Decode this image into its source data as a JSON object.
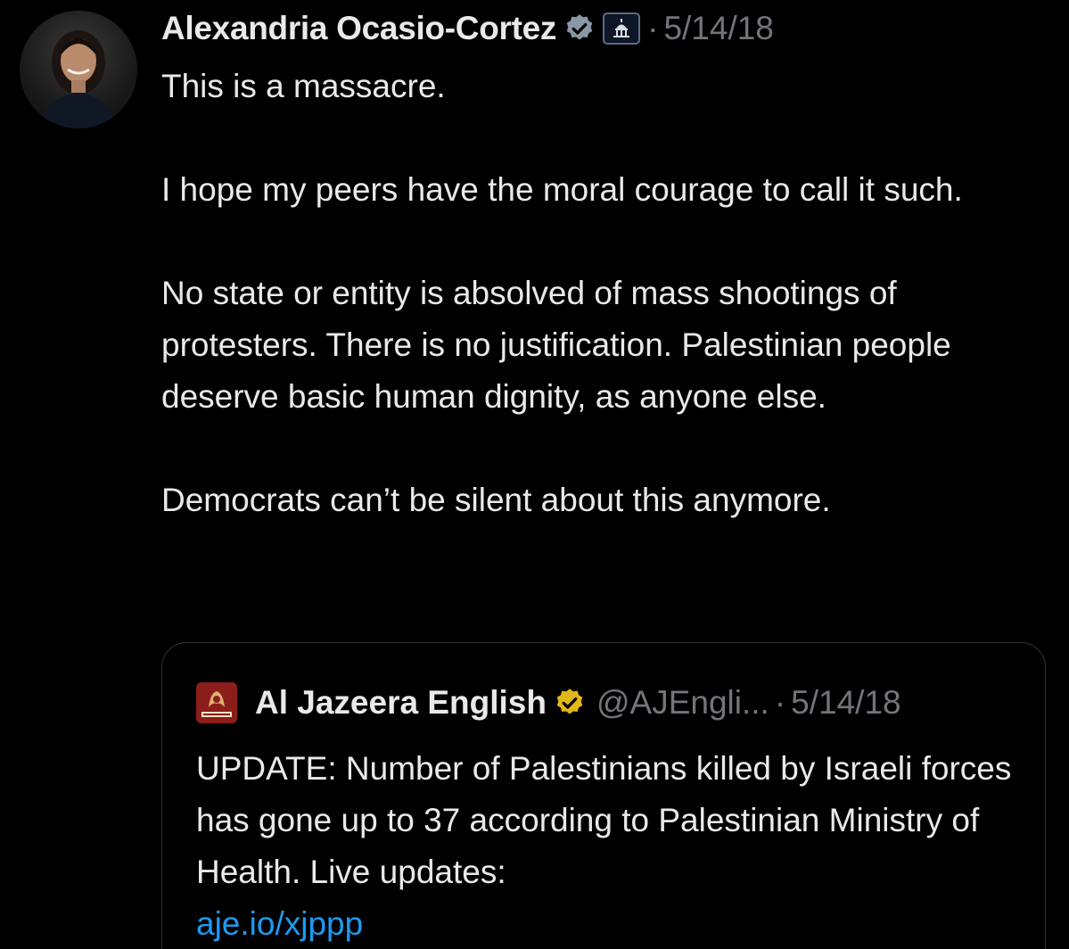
{
  "tweet": {
    "author_name": "Alexandria Ocasio-Cortez",
    "verified_icon": "verified-badge-icon",
    "affiliation_icon": "capitol-badge-icon",
    "separator": "·",
    "date": "5/14/18",
    "paragraphs": [
      "This is a massacre.",
      "I hope my peers have the moral courage to call it such.",
      "No state or entity is absolved of mass shootings of protesters. There is no justification. Palestinian people deserve basic human dignity, as anyone else.",
      "Democrats can’t be silent about this anymore."
    ]
  },
  "quote": {
    "author_name": "Al Jazeera English",
    "verified_icon": "gold-verified-badge-icon",
    "handle": "@AJEngli...",
    "separator": "·",
    "date": "5/14/18",
    "text": "UPDATE: Number of Palestinians killed by Israeli forces has gone up to 37 according to Palestinian Ministry of Health. Live updates:",
    "link": "aje.io/xjppp"
  },
  "colors": {
    "background": "#000000",
    "text": "#e7e9ea",
    "secondary": "#71767b",
    "link": "#1d9bf0",
    "verified_blue": "#8a97a6",
    "verified_gold": "#e2b719"
  }
}
